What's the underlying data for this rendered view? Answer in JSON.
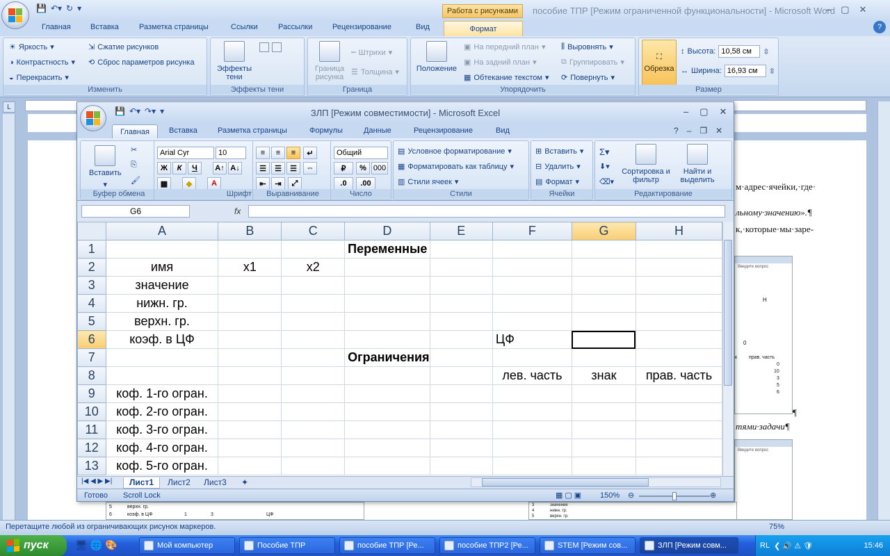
{
  "word": {
    "title": "пособие ТПР [Режим ограниченной функциональности] - Microsoft Word",
    "context_tab": "Работа с рисунками",
    "tabs": [
      "Главная",
      "Вставка",
      "Разметка страницы",
      "Ссылки",
      "Рассылки",
      "Рецензирование",
      "Вид",
      "Формат"
    ],
    "ribbon": {
      "brightness": "Яркость",
      "contrast": "Контрастность",
      "recolor": "Перекрасить",
      "compress": "Сжатие рисунков",
      "reset": "Сброс параметров рисунка",
      "group_adjust": "Изменить",
      "shadow_effects": "Эффекты тени",
      "group_shadow": "Эффекты тени",
      "border": "Граница рисунка",
      "dashes": "Штрихи",
      "weight": "Толщина",
      "group_border": "Граница",
      "position": "Положение",
      "bring_front": "На передний план",
      "send_back": "На задний план",
      "text_wrap": "Обтекание текстом",
      "align": "Выровнять",
      "group": "Группировать",
      "rotate": "Повернуть",
      "group_arrange": "Упорядочить",
      "crop": "Обрезка",
      "height_label": "Высота:",
      "height_value": "10,58 см",
      "width_label": "Ширина:",
      "width_value": "16,93 см",
      "group_size": "Размер"
    },
    "doc_lines": [
      "м·адрес·ячейки,·где·",
      "льному·значению».¶",
      "к,·которые·мы·заре-",
      "¶",
      "тями·задачи¶"
    ],
    "status": "Перетащите любой из ограничивающих рисунок маркеров.",
    "zoom": "75%"
  },
  "excel": {
    "title": "ЗЛП  [Режим совместимости] - Microsoft Excel",
    "tabs": [
      "Главная",
      "Вставка",
      "Разметка страницы",
      "Формулы",
      "Данные",
      "Рецензирование",
      "Вид"
    ],
    "ribbon": {
      "paste": "Вставить",
      "group_clipboard": "Буфер обмена",
      "font_name": "Arial Cyr",
      "font_size": "10",
      "bold": "Ж",
      "italic": "К",
      "underline": "Ч",
      "group_font": "Шрифт",
      "group_align": "Выравнивание",
      "number_format": "Общий",
      "percent": "%",
      "thousands": "000",
      "group_number": "Число",
      "cond_format": "Условное форматирование",
      "format_table": "Форматировать как таблицу",
      "cell_styles": "Стили ячеек",
      "group_styles": "Стили",
      "insert": "Вставить",
      "delete": "Удалить",
      "format": "Формат",
      "group_cells": "Ячейки",
      "sort_filter": "Сортировка и фильтр",
      "find_select": "Найти и выделить",
      "group_editing": "Редактирование"
    },
    "name_box": "G6",
    "fx": "fx",
    "columns": [
      "A",
      "B",
      "C",
      "D",
      "E",
      "F",
      "G",
      "H"
    ],
    "rows": [
      {
        "n": "1",
        "cells": [
          "",
          "",
          "",
          "Переменные",
          "",
          "",
          "",
          ""
        ]
      },
      {
        "n": "2",
        "cells": [
          "имя",
          "x1",
          "x2",
          "",
          "",
          "",
          "",
          ""
        ]
      },
      {
        "n": "3",
        "cells": [
          "значение",
          "",
          "",
          "",
          "",
          "",
          "",
          ""
        ]
      },
      {
        "n": "4",
        "cells": [
          "нижн. гр.",
          "",
          "",
          "",
          "",
          "",
          "",
          ""
        ]
      },
      {
        "n": "5",
        "cells": [
          "верхн. гр.",
          "",
          "",
          "",
          "",
          "",
          "",
          ""
        ]
      },
      {
        "n": "6",
        "cells": [
          "коэф. в ЦФ",
          "",
          "",
          "",
          "",
          "ЦФ",
          "",
          ""
        ]
      },
      {
        "n": "7",
        "cells": [
          "",
          "",
          "",
          "Ограничения",
          "",
          "",
          "",
          ""
        ]
      },
      {
        "n": "8",
        "cells": [
          "",
          "",
          "",
          "",
          "",
          "лев. часть",
          "знак",
          "прав. часть"
        ]
      },
      {
        "n": "9",
        "cells": [
          "коф. 1-го огран.",
          "",
          "",
          "",
          "",
          "",
          "",
          ""
        ]
      },
      {
        "n": "10",
        "cells": [
          "коф. 2-го огран.",
          "",
          "",
          "",
          "",
          "",
          "",
          ""
        ]
      },
      {
        "n": "11",
        "cells": [
          "коф. 3-го огран.",
          "",
          "",
          "",
          "",
          "",
          "",
          ""
        ]
      },
      {
        "n": "12",
        "cells": [
          "коф. 4-го огран.",
          "",
          "",
          "",
          "",
          "",
          "",
          ""
        ]
      },
      {
        "n": "13",
        "cells": [
          "коф. 5-го огран.",
          "",
          "",
          "",
          "",
          "",
          "",
          ""
        ]
      }
    ],
    "sheets": [
      "Лист1",
      "Лист2",
      "Лист3"
    ],
    "status_ready": "Готово",
    "status_scroll": "Scroll Lock",
    "zoom": "150%"
  },
  "taskbar": {
    "start": "пуск",
    "tasks": [
      "Мой компьютер",
      "Пособие ТПР",
      "пособие ТПР [Ре...",
      "пособие ТПР2 [Ре...",
      "STEM  [Режим сов...",
      "ЗЛП  [Режим совм..."
    ],
    "lang": "RL",
    "clock": "15:46"
  },
  "thumbs": {
    "t1_rows": [
      "5",
      "6"
    ],
    "t1_labels": [
      "верхн. гр.",
      "коэф. в ЦФ"
    ],
    "t1_vals": [
      "1",
      "3",
      "ЦФ"
    ],
    "t2_rows": [
      "3",
      "4",
      "5"
    ],
    "t2_labels": [
      "значение",
      "нижн. гр.",
      "верхн. гр."
    ],
    "t3_title": "Введите вопрос",
    "t3_col": "H",
    "t3_header": "прав. часть",
    "t3_values": [
      "0",
      "10",
      "3",
      "5",
      "6"
    ],
    "t3_zero": "0",
    "t3_k": "к"
  }
}
